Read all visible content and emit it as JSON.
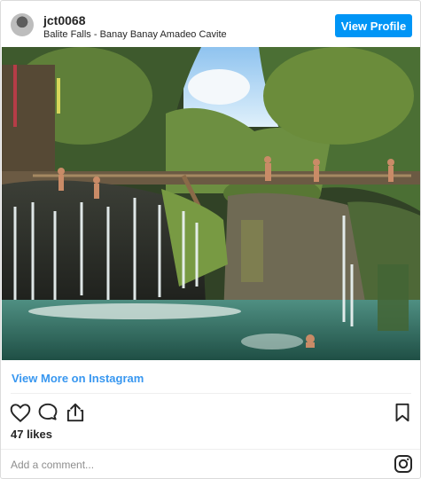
{
  "post": {
    "username": "jct0068",
    "location": "Balite Falls - Banay Banay Amadeo Cavite",
    "view_profile_label": "View Profile",
    "view_more_label": "View More on Instagram",
    "likes": "47 likes",
    "comment_placeholder": "Add a comment..."
  },
  "icons": {
    "like": "heart-icon",
    "comment": "comment-icon",
    "share": "share-icon",
    "save": "bookmark-icon",
    "brand": "instagram-icon"
  },
  "colors": {
    "accent": "#0095f6",
    "link": "#3897f0",
    "muted": "#8e8e8e",
    "text": "#262626"
  }
}
